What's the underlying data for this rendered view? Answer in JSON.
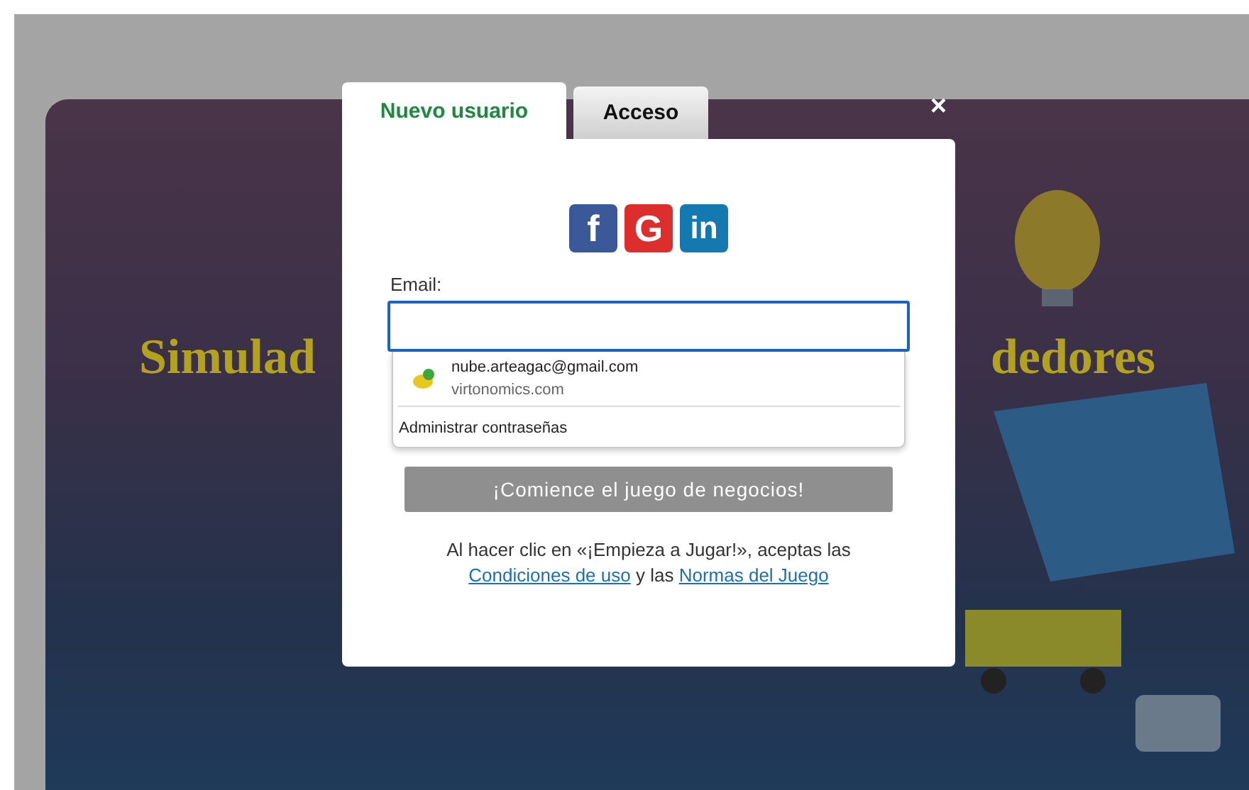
{
  "background": {
    "title_left": "Simulad",
    "title_right": "dedores"
  },
  "dialog": {
    "tabs": [
      {
        "label": "Nuevo usuario",
        "selected": true
      },
      {
        "label": "Acceso",
        "selected": false
      }
    ],
    "close": "×",
    "social": [
      {
        "kind": "facebook",
        "glyph": "f"
      },
      {
        "kind": "google",
        "glyph": "G"
      },
      {
        "kind": "linkedin",
        "glyph": "in"
      }
    ],
    "email": {
      "label": "Email:",
      "focused": true
    },
    "autofill": {
      "suggestions": [
        {
          "username": "nube.arteagac@gmail.com",
          "site": "virtonomics.com"
        }
      ],
      "manage": "Administrar contraseñas"
    },
    "submit": {
      "label": "¡Comience el juego de negocios!",
      "disabled": true
    },
    "legal": [
      {
        "kind": "text",
        "text": "Al hacer clic en «¡Empieza a Jugar!», aceptas las"
      },
      {
        "kind": "link",
        "text": "Condiciones de uso"
      },
      {
        "kind": "text",
        "text": "y las"
      },
      {
        "kind": "link",
        "text": "Normas del Juego"
      }
    ]
  }
}
